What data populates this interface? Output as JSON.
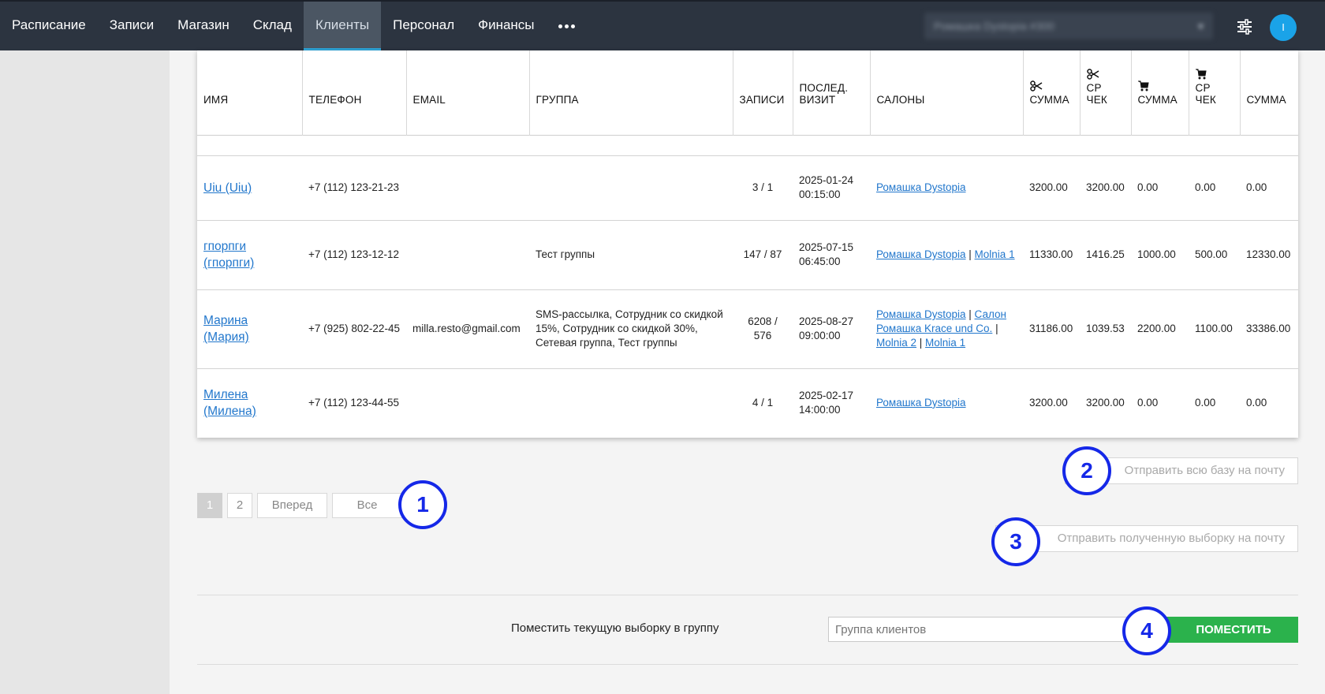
{
  "nav": {
    "items": [
      "Расписание",
      "Записи",
      "Магазин",
      "Склад",
      "Клиенты",
      "Персонал",
      "Финансы"
    ],
    "active_index": 4,
    "salon_select": "Ромашка Dystopia #300",
    "avatar_letter": "I"
  },
  "table": {
    "headers": [
      "ИМЯ",
      "ТЕЛЕФОН",
      "EMAIL",
      "ГРУППА",
      "ЗАПИСИ",
      "ПОСЛЕД. ВИЗИТ",
      "САЛОНЫ",
      "СУММА",
      "СР ЧЕК",
      "СУММА",
      "СР ЧЕК",
      "СУММА"
    ],
    "header_icons": [
      "",
      "",
      "",
      "",
      "",
      "",
      "",
      "scissors-icon",
      "scissors-icon",
      "cart-icon",
      "cart-icon",
      ""
    ],
    "rows": [
      {
        "name": "Uiu (Uiu)",
        "phone": "+7 (112) 123-21-23",
        "email": "",
        "group": "",
        "records": "3 / 1",
        "last_visit_date": "2025-01-24",
        "last_visit_time": "00:15:00",
        "salons": [
          "Ромашка Dystopia"
        ],
        "sum1": "3200.00",
        "avg1": "3200.00",
        "sum2": "0.00",
        "avg2": "0.00",
        "sum3": "0.00"
      },
      {
        "name": "гпорпги (гпорпги)",
        "phone": "+7 (112) 123-12-12",
        "email": "",
        "group": "Тест группы",
        "records": "147 / 87",
        "last_visit_date": "2025-07-15",
        "last_visit_time": "06:45:00",
        "salons": [
          "Ромашка Dystopia",
          "Molnia 1"
        ],
        "sum1": "11330.00",
        "avg1": "1416.25",
        "sum2": "1000.00",
        "avg2": "500.00",
        "sum3": "12330.00"
      },
      {
        "name": "Марина (Мария)",
        "phone": "+7 (925) 802-22-45",
        "email": "milla.resto@gmail.com",
        "group": "SMS-рассылка, Сотрудник со скидкой 15%, Сотрудник со скидкой 30%, Сетевая группа, Тест группы",
        "records": "6208 / 576",
        "last_visit_date": "2025-08-27",
        "last_visit_time": "09:00:00",
        "salons": [
          "Ромашка Dystopia",
          "Салон Ромашка Krace und Co.",
          "Molnia 2",
          "Molnia 1"
        ],
        "sum1": "31186.00",
        "avg1": "1039.53",
        "sum2": "2200.00",
        "avg2": "1100.00",
        "sum3": "33386.00"
      },
      {
        "name": "Милена (Милена)",
        "phone": "+7 (112) 123-44-55",
        "email": "",
        "group": "",
        "records": "4 / 1",
        "last_visit_date": "2025-02-17",
        "last_visit_time": "14:00:00",
        "salons": [
          "Ромашка Dystopia"
        ],
        "sum1": "3200.00",
        "avg1": "3200.00",
        "sum2": "0.00",
        "avg2": "0.00",
        "sum3": "0.00"
      }
    ]
  },
  "pagination": {
    "pages": [
      "1",
      "2"
    ],
    "active": "1",
    "next_label": "Вперед",
    "all_label": "Все"
  },
  "actions": {
    "send_all": "Отправить всю базу на почту",
    "send_selection": "Отправить полученную выборку на почту",
    "group_label": "Поместить текущую выборку в группу",
    "group_placeholder": "Группа клиентов",
    "place_button": "ПОМЕСТИТЬ"
  },
  "markers": [
    "1",
    "2",
    "3",
    "4"
  ]
}
